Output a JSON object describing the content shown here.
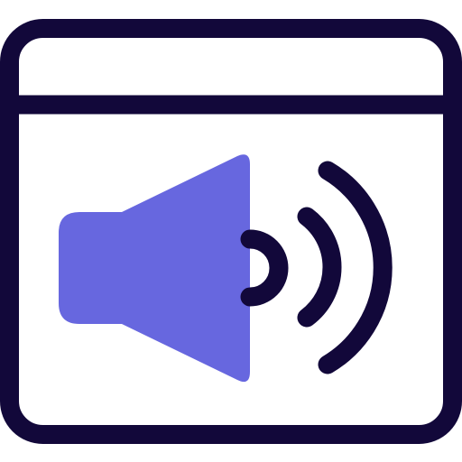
{
  "icon": {
    "name": "browser-audio-icon",
    "parts": [
      "browser-window-frame-icon",
      "speaker-icon",
      "sound-waves-icon"
    ]
  },
  "colors": {
    "outline": "#12083a",
    "speaker_fill": "#6767df",
    "background": "#ffffff"
  }
}
